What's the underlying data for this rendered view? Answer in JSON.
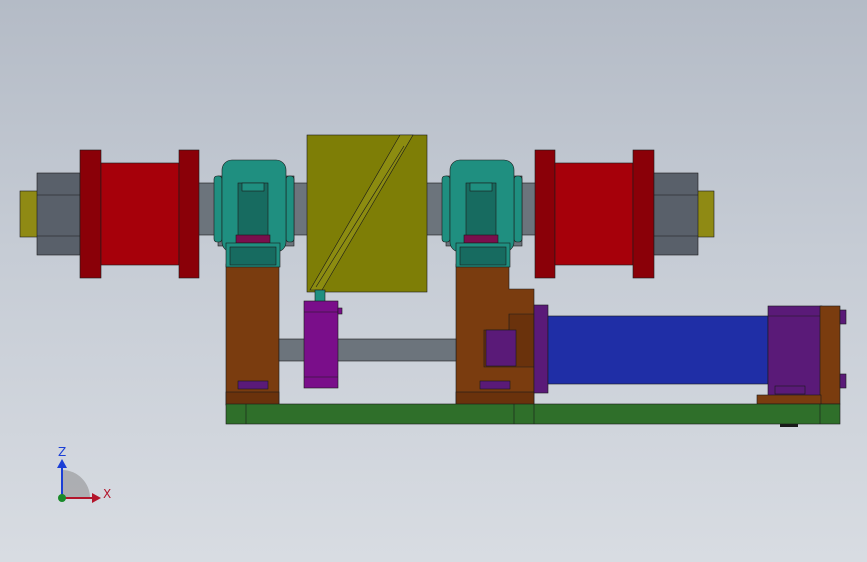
{
  "axes_triad": {
    "z_label": "Z",
    "x_label": "X",
    "colors": {
      "z_axis": "#1b3fd6",
      "x_axis": "#b3152b",
      "origin": "#1a8a2a",
      "quadrant": "#8c8c8c"
    }
  },
  "palette": {
    "background_top": "#b4bbc6",
    "background_bottom": "#d8dce2",
    "shaft": "#6c747c",
    "shaft_end": "#8f8a14",
    "nut": "#59606a",
    "drum": "#a6000a",
    "drum_flange": "#8a0008",
    "pillow_block": "#1f8f80",
    "pillow_dark": "#176b60",
    "bearing_base": "#7a0f4d",
    "roller_yellow": "#7e7e06",
    "support_brown": "#7a3c0f",
    "base_green": "#2f6f2a",
    "cylinder_blue": "#1f2ea6",
    "cylinder_purple": "#5a1a78",
    "motor_purple": "#7a0e8a",
    "outline": "#1a1a1a"
  }
}
